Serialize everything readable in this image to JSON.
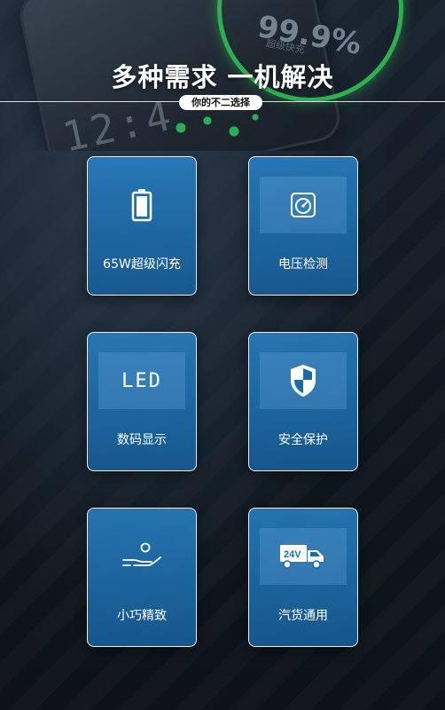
{
  "hero": {
    "charge_percent": "99.9%",
    "charge_caption": "超级快充",
    "clock": "12:4"
  },
  "headline": "多种需求  一机解决",
  "tagline": "你的不二选择",
  "features": [
    {
      "label": "65W超级闪充",
      "icon": "battery-icon"
    },
    {
      "label": "电压检测",
      "icon": "voltmeter-icon"
    },
    {
      "label": "数码显示",
      "icon": "led-display-icon",
      "icon_text": "LED"
    },
    {
      "label": "安全保护",
      "icon": "shield-icon"
    },
    {
      "label": "小巧精致",
      "icon": "hand-holding-icon"
    },
    {
      "label": "汽货通用",
      "icon": "truck-icon",
      "icon_text": "24V"
    }
  ],
  "colors": {
    "card_blue": "#1f7fc4",
    "accent_green": "#2fae4e",
    "background": "#131c25"
  }
}
